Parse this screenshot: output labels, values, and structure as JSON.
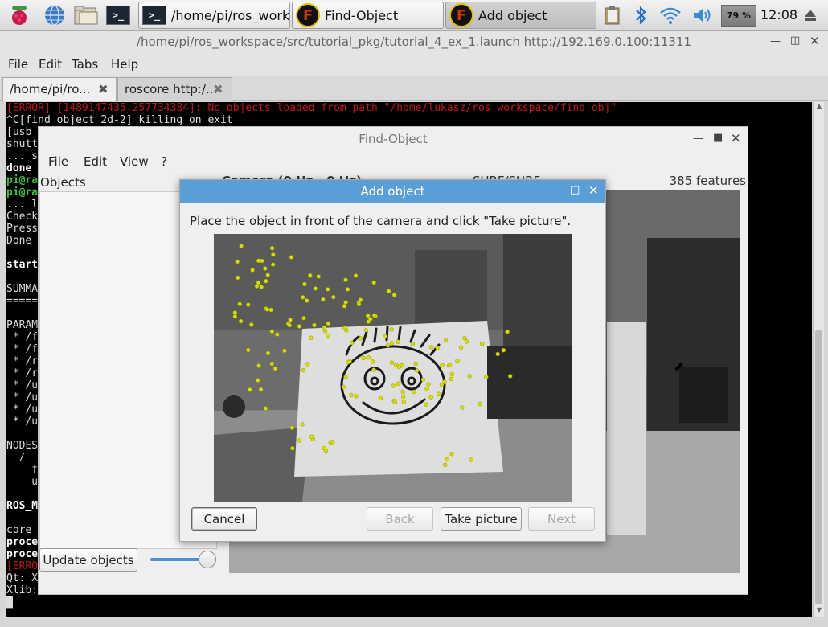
{
  "panel": {
    "tasks": [
      {
        "label": "/home/pi/ros_work..."
      },
      {
        "label": "Find-Object"
      },
      {
        "label": "Add object"
      }
    ],
    "battery": "79 %",
    "clock": "12:08"
  },
  "terminal": {
    "title": "/home/pi/ros_workspace/src/tutorial_pkg/tutorial_4_ex_1.launch http://192.169.0.100:11311",
    "menu": [
      "File",
      "Edit",
      "Tabs",
      "Help"
    ],
    "tabs": [
      {
        "label": "/home/pi/ro..."
      },
      {
        "label": "roscore http:/..."
      }
    ],
    "lines": [
      {
        "text": "[ERROR] [1489147435.257734384]: No objects loaded from path \"/home/lukasz/ros_workspace/find_obj\"",
        "color": "#c01818"
      },
      {
        "text": "^C[find_object_2d-2] killing on exit",
        "color": "#dddddd"
      },
      {
        "text": "[usb_",
        "color": "#dddddd"
      },
      {
        "text": "shutt",
        "color": "#dddddd"
      },
      {
        "text": "... s",
        "color": "#dddddd"
      },
      {
        "text": "done",
        "color": "#ffffff"
      },
      {
        "text": "pi@ra",
        "color": "#3fbf3f"
      },
      {
        "text": "pi@ra",
        "color": "#3fbf3f"
      },
      {
        "text": "... l",
        "color": "#dddddd"
      },
      {
        "text": "Check",
        "color": "#dddddd"
      },
      {
        "text": "Press",
        "color": "#dddddd"
      },
      {
        "text": "Done ",
        "color": "#dddddd"
      },
      {
        "text": "",
        "color": "#dddddd"
      },
      {
        "text": "start",
        "color": "#ffffff"
      },
      {
        "text": "",
        "color": "#dddddd"
      },
      {
        "text": "SUMMA",
        "color": "#dddddd"
      },
      {
        "text": "=====",
        "color": "#dddddd"
      },
      {
        "text": "",
        "color": "#dddddd"
      },
      {
        "text": "PARAM",
        "color": "#dddddd"
      },
      {
        "text": " * /f",
        "color": "#dddddd"
      },
      {
        "text": " * /f",
        "color": "#dddddd"
      },
      {
        "text": " * /r",
        "color": "#dddddd"
      },
      {
        "text": " * /r",
        "color": "#dddddd"
      },
      {
        "text": " * /u",
        "color": "#dddddd"
      },
      {
        "text": " * /u",
        "color": "#dddddd"
      },
      {
        "text": " * /u",
        "color": "#dddddd"
      },
      {
        "text": " * /u",
        "color": "#dddddd"
      },
      {
        "text": "",
        "color": "#dddddd"
      },
      {
        "text": "NODES",
        "color": "#dddddd"
      },
      {
        "text": "  /",
        "color": "#dddddd"
      },
      {
        "text": "    f",
        "color": "#dddddd"
      },
      {
        "text": "    u",
        "color": "#dddddd"
      },
      {
        "text": "",
        "color": "#dddddd"
      },
      {
        "text": "ROS_M",
        "color": "#ffffff"
      },
      {
        "text": "",
        "color": "#dddddd"
      },
      {
        "text": "core ",
        "color": "#dddddd"
      },
      {
        "text": "proce",
        "color": "#ffffff"
      },
      {
        "text": "proce",
        "color": "#ffffff"
      },
      {
        "text": "[ERRO",
        "color": "#c01818"
      },
      {
        "text": "Qt: X",
        "color": "#dddddd"
      },
      {
        "text": "Xlib:",
        "color": "#dddddd"
      },
      {
        "text": "█",
        "color": "#dddddd"
      }
    ]
  },
  "findobject": {
    "title": "Find-Object",
    "menu": [
      "File",
      "Edit",
      "View",
      "?"
    ],
    "objects_label": "Objects",
    "camera_label": "Camera (0 Hz - 0 Hz)",
    "detector_label": "SURF/SURF",
    "features": "385 features",
    "update_button": "Update objects",
    "slider_value": 1.0
  },
  "dialog": {
    "title": "Add object",
    "instruction": "Place the object in front of the camera and click \"Take picture\".",
    "buttons": {
      "cancel": "Cancel",
      "back": "Back",
      "take": "Take picture",
      "next": "Next"
    }
  },
  "colors": {
    "accent": "#5a9ed8",
    "keypoint": "#d8e000",
    "error": "#c01818",
    "prompt": "#3fbf3f"
  }
}
